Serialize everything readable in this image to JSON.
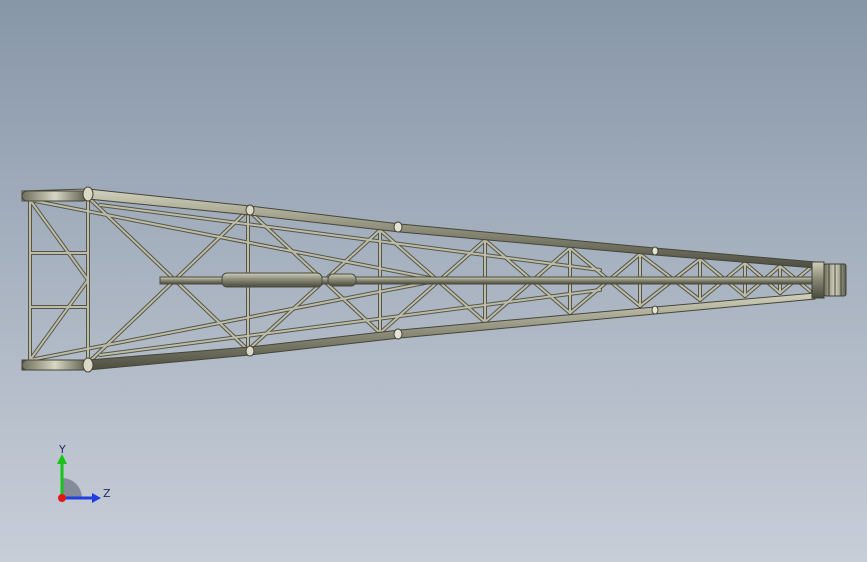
{
  "triad": {
    "y_label": "Y",
    "z_label": "Z",
    "colors": {
      "y": "#19c419",
      "z": "#1f3fe0",
      "x": "#e01818",
      "plane": "#7a8090"
    }
  },
  "scene": {
    "icon": "truss-boom-model",
    "colors": {
      "chord_dark": "#4a4a3c",
      "chord_mid": "#8a8a76",
      "chord_light": "#c9c9b4",
      "brace": "#b8b8a2",
      "brace_outline": "#55554a"
    }
  }
}
